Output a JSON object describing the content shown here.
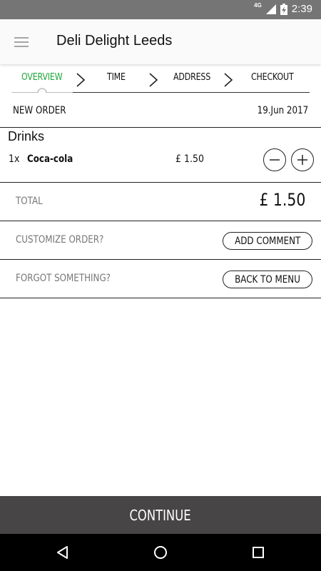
{
  "status_bar": {
    "network": "4G",
    "time": "2:39"
  },
  "app_bar": {
    "title": "Deli Delight Leeds",
    "menu_icon": "hamburger-menu-icon"
  },
  "steps": [
    {
      "label": "OVERVIEW",
      "active": true
    },
    {
      "label": "TIME",
      "active": false
    },
    {
      "label": "ADDRESS",
      "active": false
    },
    {
      "label": "CHECKOUT",
      "active": false
    }
  ],
  "accent_color": "#1fa63a",
  "order": {
    "label": "NEW ORDER",
    "date": "19.Jun 2017"
  },
  "section": {
    "title": "Drinks"
  },
  "items": [
    {
      "qty": "1x",
      "name": "Coca-cola",
      "price": "£ 1.50"
    }
  ],
  "total": {
    "label": "TOTAL",
    "value": "£ 1.50"
  },
  "customize": {
    "label": "CUSTOMIZE ORDER?",
    "button": "ADD COMMENT"
  },
  "forgot": {
    "label": "FORGOT SOMETHING?",
    "button": "BACK TO MENU"
  },
  "continue_label": "CONTINUE",
  "nav": {
    "back_icon": "back-triangle-icon",
    "home_icon": "home-circle-icon",
    "recents_icon": "recents-square-icon"
  }
}
